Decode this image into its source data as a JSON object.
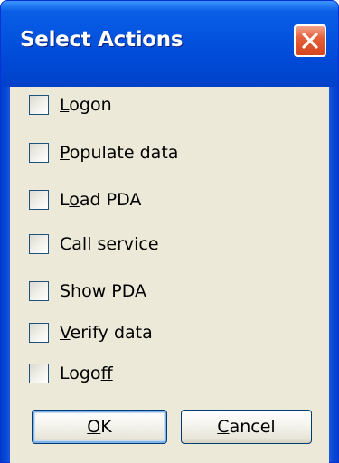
{
  "window": {
    "title": "Select Actions",
    "close_icon": "close-icon",
    "titlebar_color": "#0a49d8",
    "close_color": "#d4451f",
    "client_background": "#ece9d8"
  },
  "actions": [
    {
      "pre": "",
      "accel": "L",
      "post": "ogon",
      "checked": false
    },
    {
      "pre": "",
      "accel": "P",
      "post": "opulate data",
      "checked": false
    },
    {
      "pre": "L",
      "accel": "o",
      "post": "ad PDA",
      "checked": false
    },
    {
      "pre": "Call service",
      "accel": "",
      "post": "",
      "checked": false
    },
    {
      "pre": "Show PDA",
      "accel": "",
      "post": "",
      "checked": false
    },
    {
      "pre": "",
      "accel": "V",
      "post": "erify data",
      "checked": false
    },
    {
      "pre": "Logo",
      "accel": "f",
      "post": "f",
      "checked": false
    }
  ],
  "buttons": {
    "ok": {
      "pre": "",
      "accel": "O",
      "post": "K"
    },
    "cancel": {
      "pre": "",
      "accel": "C",
      "post": "ancel"
    }
  }
}
